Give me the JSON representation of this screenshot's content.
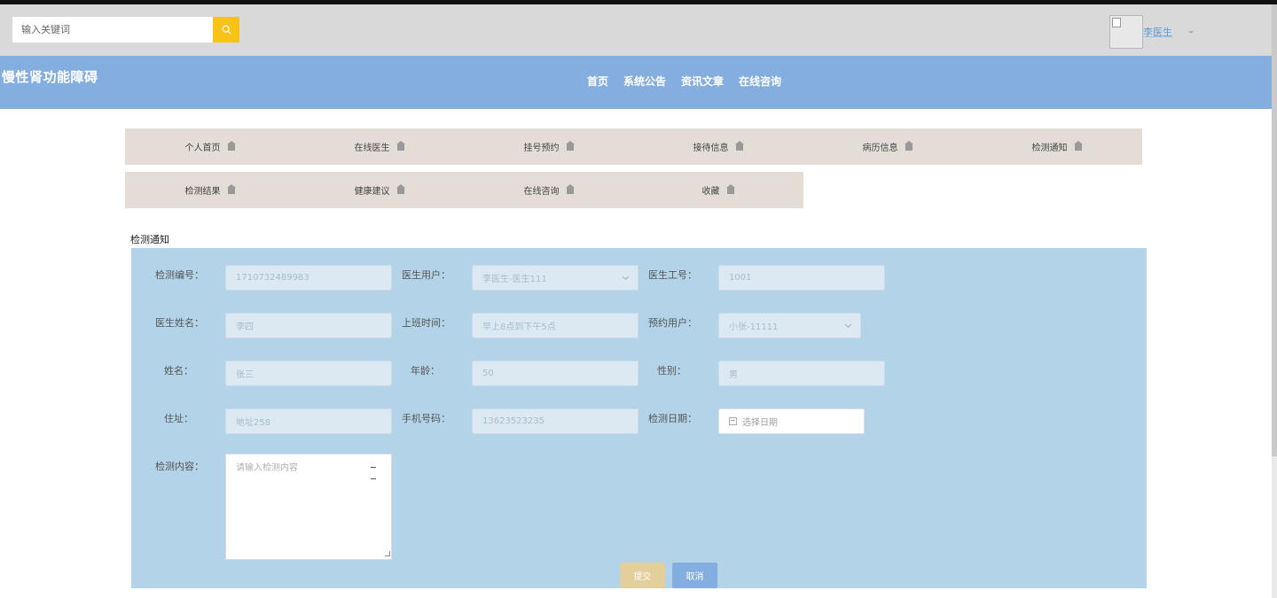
{
  "header": {
    "search": {
      "placeholder": "输入关键词"
    },
    "user": {
      "name": "李医生"
    }
  },
  "navbar": {
    "site_title": "慢性肾功能障碍",
    "links": [
      "首页",
      "系统公告",
      "资讯文章",
      "在线咨询"
    ]
  },
  "menu": {
    "row1": [
      "个人首页",
      "在线医生",
      "挂号预约",
      "接待信息",
      "病历信息",
      "检测通知"
    ],
    "row2": [
      "检测结果",
      "健康建议",
      "在线咨询",
      "收藏"
    ]
  },
  "form": {
    "section_title": "检测通知",
    "labels": {
      "test_no": "检测编号：",
      "doctor_user": "医生用户：",
      "doctor_id": "医生工号：",
      "doctor_name": "医生姓名：",
      "work_time": "上班时间：",
      "booking_user": "预约用户：",
      "name": "姓名：",
      "age": "年龄：",
      "gender": "性别：",
      "address": "住址：",
      "phone": "手机号码：",
      "test_date": "检测日期：",
      "content": "检测内容："
    },
    "values": {
      "test_no": "1710732489983",
      "doctor_user": "李医生-医生111",
      "doctor_id": "1001",
      "doctor_name": "李四",
      "work_time": "早上8点到下午5点",
      "booking_user": "小张-11111",
      "name": "张三",
      "age": "50",
      "gender": "男",
      "address": "地址258",
      "phone": "13623523235"
    },
    "placeholders": {
      "test_date": "选择日期",
      "content": "请输入检测内容"
    },
    "buttons": {
      "submit": "提交",
      "cancel": "取消"
    }
  },
  "colors": {
    "topbar": "#d9d9d9",
    "navbar": "#85aee0",
    "search_button": "#f9c315",
    "menu_bg": "#e3ddd5",
    "form_bg": "#b3d4e8",
    "submit": "#e2cf9b",
    "cancel": "#85aee0"
  }
}
